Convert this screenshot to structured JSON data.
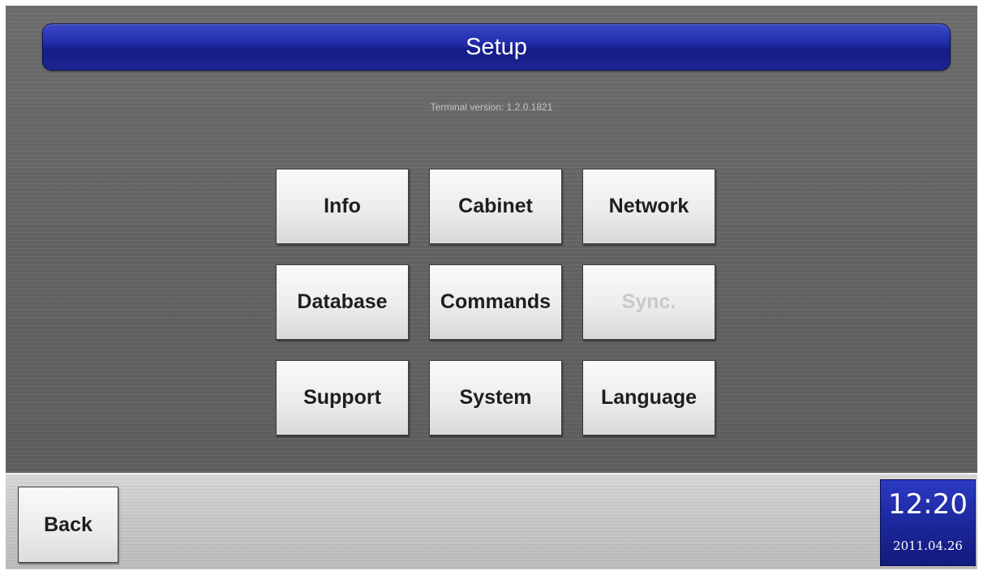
{
  "header": {
    "title": "Setup",
    "version_text": "Terminal version: 1.2.0.1821"
  },
  "menu": {
    "buttons": [
      {
        "label": "Info",
        "enabled": true
      },
      {
        "label": "Cabinet",
        "enabled": true
      },
      {
        "label": "Network",
        "enabled": true
      },
      {
        "label": "Database",
        "enabled": true
      },
      {
        "label": "Commands",
        "enabled": true
      },
      {
        "label": "Sync.",
        "enabled": false
      },
      {
        "label": "Support",
        "enabled": true
      },
      {
        "label": "System",
        "enabled": true
      },
      {
        "label": "Language",
        "enabled": true
      }
    ]
  },
  "footer": {
    "back_label": "Back",
    "time": "12:20",
    "date": "2011.04.26"
  },
  "colors": {
    "title_bar": "#1f2aa6",
    "clock_background": "#1c289c",
    "disabled_text": "#c9c9c9",
    "button_text": "#1e1e1e"
  }
}
